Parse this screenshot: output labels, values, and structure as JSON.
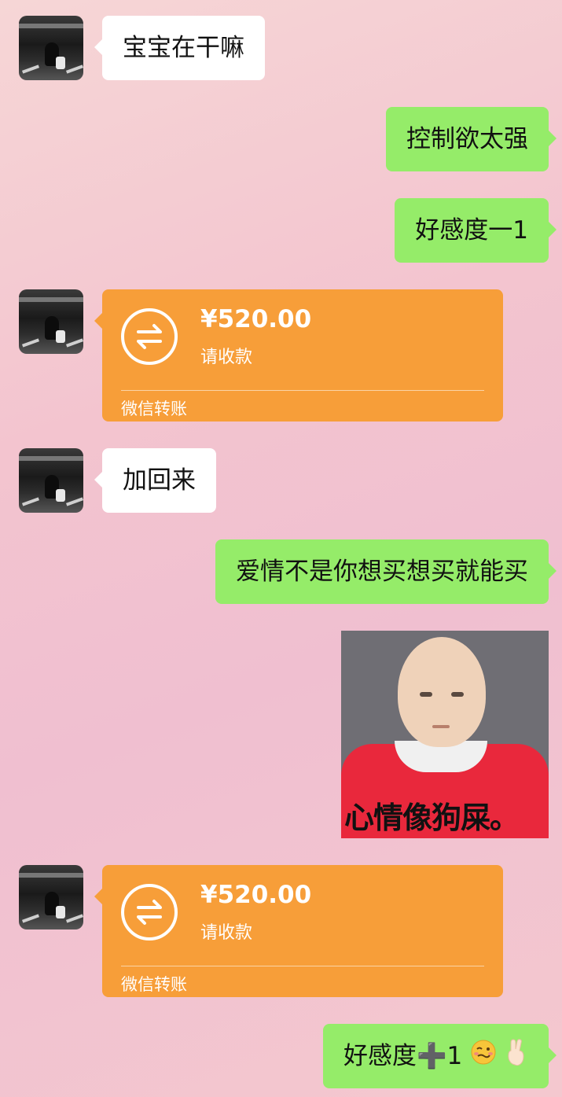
{
  "messages": {
    "m1": "宝宝在干嘛",
    "m2": "控制欲太强",
    "m3": "好感度一1",
    "m5": "加回来",
    "m6": "爱情不是你想买想买就能买",
    "m8_text": "好感度➕1"
  },
  "transfer": {
    "amount": "¥520.00",
    "status": "请收款",
    "brand": "微信转账",
    "color": "#f79e39"
  },
  "sticker": {
    "caption": "心情像狗屎。"
  },
  "icons": {
    "transfer": "transfer-arrows-icon",
    "emoji_1": "woozy-face-emoji",
    "emoji_2": "crossed-fingers-emoji"
  },
  "colors": {
    "incoming_bubble": "#ffffff",
    "outgoing_bubble": "#95ec69"
  }
}
